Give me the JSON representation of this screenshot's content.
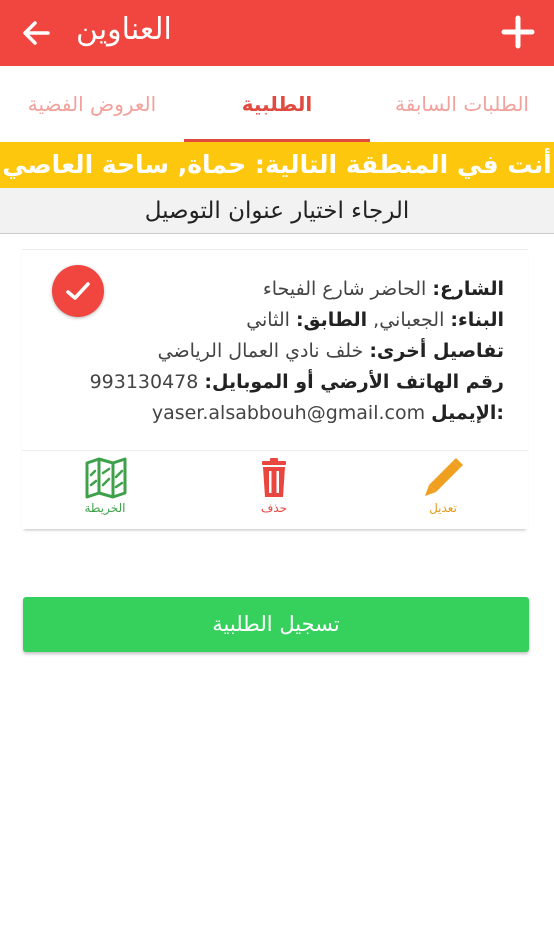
{
  "appbar": {
    "title": "العناوين",
    "back_icon": "arrow-left-icon",
    "add_icon": "plus-icon",
    "color": "#f0463f"
  },
  "tabs": [
    {
      "label": "الطلبات السابقة",
      "active": false
    },
    {
      "label": "الطلبية",
      "active": true
    },
    {
      "label": "العروض الفضية",
      "active": false
    }
  ],
  "location_banner": "أنت في المنطقة التالية: حماة, ساحة العاصي",
  "instruction": "الرجاء اختيار عنوان التوصيل",
  "address": {
    "selected": true,
    "street_label": "الشارع:",
    "street_value": "الحاضر شارع الفيحاء",
    "building_label": "البناء:",
    "building_value": "الجعباني,",
    "floor_label": "الطابق:",
    "floor_value": "الثاني",
    "other_label": "تفاصيل أخرى:",
    "other_value": "خلف نادي العمال الرياضي",
    "phone_label": "رقم الهاتف الأرضي أو الموبايل:",
    "phone_value": "993130478",
    "email_label": ":الإيميل",
    "email_value": "yaser.alsabbouh@gmail.com"
  },
  "actions": {
    "edit_label": "تعديل",
    "delete_label": "حذف",
    "map_label": "الخريطة"
  },
  "submit_label": "تسجيل الطلبية",
  "colors": {
    "primary": "#f0463f",
    "banner": "#fdc70d",
    "submit": "#35d15c",
    "edit": "#f0a020",
    "delete": "#e8463f",
    "map": "#3ea14a"
  }
}
